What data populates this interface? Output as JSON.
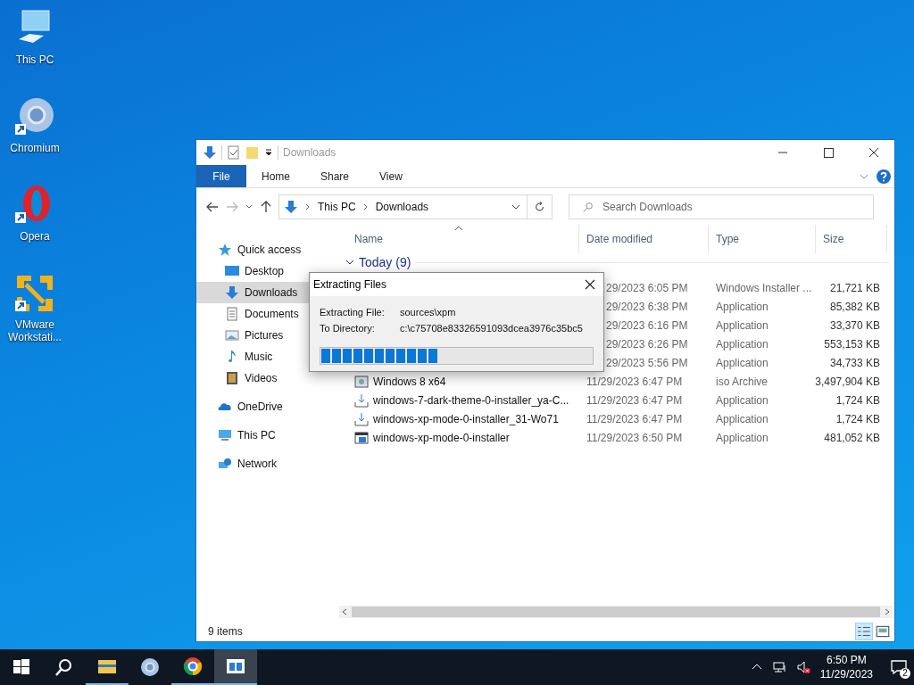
{
  "desktop_icons": [
    {
      "label": "This PC",
      "kind": "pc",
      "shortcut": false
    },
    {
      "label": "Chromium",
      "kind": "chromium",
      "shortcut": true
    },
    {
      "label": "Opera",
      "kind": "opera",
      "shortcut": true
    },
    {
      "label": "VMware Workstati...",
      "kind": "vmware",
      "shortcut": true
    }
  ],
  "window": {
    "title": "Downloads",
    "ribbon_tabs": [
      {
        "label": "File",
        "kind": "menu"
      },
      {
        "label": "Home",
        "kind": "tab"
      },
      {
        "label": "Share",
        "kind": "tab"
      },
      {
        "label": "View",
        "kind": "tab"
      }
    ],
    "breadcrumb": [
      "This PC",
      "Downloads"
    ],
    "search": {
      "placeholder": "Search Downloads"
    },
    "nav": [
      {
        "label": "Quick access",
        "kind": "star",
        "selected": false,
        "children": [
          {
            "label": "Desktop",
            "kind": "desktop",
            "selected": false
          },
          {
            "label": "Downloads",
            "kind": "download",
            "selected": true
          },
          {
            "label": "Documents",
            "kind": "document",
            "selected": false
          },
          {
            "label": "Pictures",
            "kind": "pictures",
            "selected": false
          },
          {
            "label": "Music",
            "kind": "music",
            "selected": false
          },
          {
            "label": "Videos",
            "kind": "videos",
            "selected": false
          }
        ]
      },
      {
        "label": "OneDrive",
        "kind": "cloud",
        "selected": false
      },
      {
        "label": "This PC",
        "kind": "pc",
        "selected": false
      },
      {
        "label": "Network",
        "kind": "network",
        "selected": false
      }
    ],
    "columns": [
      {
        "label": "Name",
        "sorted": true
      },
      {
        "label": "Date modified",
        "sorted": false
      },
      {
        "label": "Type",
        "sorted": false
      },
      {
        "label": "Size",
        "sorted": false
      }
    ],
    "group": {
      "label": "Today (9)",
      "expanded": true
    },
    "rows": [
      {
        "kind": "covered",
        "date": "29/2023 6:05 PM",
        "type": "Windows Installer ...",
        "size": "21,721 KB"
      },
      {
        "kind": "covered",
        "date": "29/2023 6:38 PM",
        "type": "Application",
        "size": "85,382 KB"
      },
      {
        "kind": "covered",
        "date": "29/2023 6:16 PM",
        "type": "Application",
        "size": "33,370 KB"
      },
      {
        "kind": "covered",
        "date": "29/2023 6:26 PM",
        "type": "Application",
        "size": "553,153 KB"
      },
      {
        "kind": "covered",
        "date": "29/2023 5:56 PM",
        "type": "Application",
        "size": "34,733 KB"
      },
      {
        "kind": "disc",
        "name": "Windows 8 x64",
        "date": "11/29/2023 6:47 PM",
        "type": "iso Archive",
        "size": "3,497,904 KB"
      },
      {
        "kind": "download",
        "name": "windows-7-dark-theme-0-installer_ya-C...",
        "date": "11/29/2023 6:47 PM",
        "type": "Application",
        "size": "1,724 KB"
      },
      {
        "kind": "download",
        "name": "windows-xp-mode-0-installer_31-Wo71",
        "date": "11/29/2023 6:47 PM",
        "type": "Application",
        "size": "1,724 KB"
      },
      {
        "kind": "program",
        "name": "windows-xp-mode-0-installer",
        "date": "11/29/2023 6:50 PM",
        "type": "Application",
        "size": "481,052 KB"
      }
    ],
    "status_bar": "9 items"
  },
  "dialog": {
    "title": "Extracting Files",
    "fields": [
      {
        "label": "Extracting File:",
        "value": "sources\\xpm"
      },
      {
        "label": "To Directory:",
        "value": "c:\\c75708e83326591093dcea3976c35bc5"
      }
    ],
    "level": 0.43
  },
  "taskbar": {
    "items": [
      {
        "kind": "start",
        "running": false,
        "selected": false
      },
      {
        "kind": "search",
        "running": false,
        "selected": false
      },
      {
        "kind": "explorer",
        "running": true,
        "selected": false
      },
      {
        "kind": "chromium",
        "running": false,
        "selected": false
      },
      {
        "kind": "chrome",
        "running": true,
        "selected": false
      },
      {
        "kind": "app",
        "running": true,
        "selected": true
      }
    ],
    "time": "6:50 PM",
    "date": "11/29/2023",
    "notifications": "2"
  }
}
